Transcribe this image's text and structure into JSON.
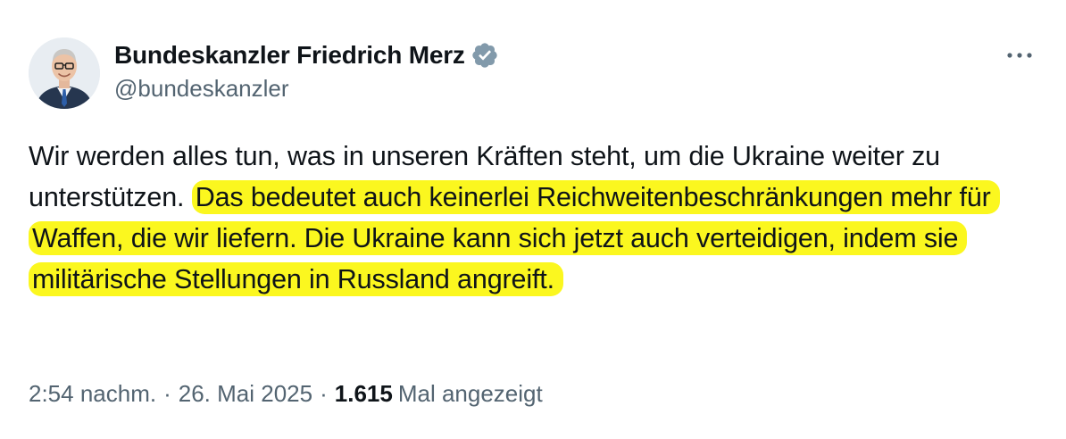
{
  "author": {
    "display_name": "Bundeskanzler Friedrich Merz",
    "handle": "@bundeskanzler",
    "verified_icon": "verified-badge-gray",
    "badge_color": "#829aab"
  },
  "tweet": {
    "text_plain": "Wir werden alles tun, was in unseren Kräften steht, um die Ukraine weiter zu unterstützen. ",
    "text_highlighted": "Das bedeutet auch keinerlei Reichweitenbeschränkungen mehr für Waffen, die wir liefern. Die Ukraine kann sich jetzt auch verteidigen, indem sie militärische Stellungen in Russland angreift.",
    "highlight_color": "#fbf71f"
  },
  "meta": {
    "time": "2:54 nachm.",
    "date": "26. Mai 2025",
    "separator": "·",
    "views_count": "1.615",
    "views_label": "Mal angezeigt"
  },
  "menu": {
    "icon": "more-horizontal-icon"
  }
}
